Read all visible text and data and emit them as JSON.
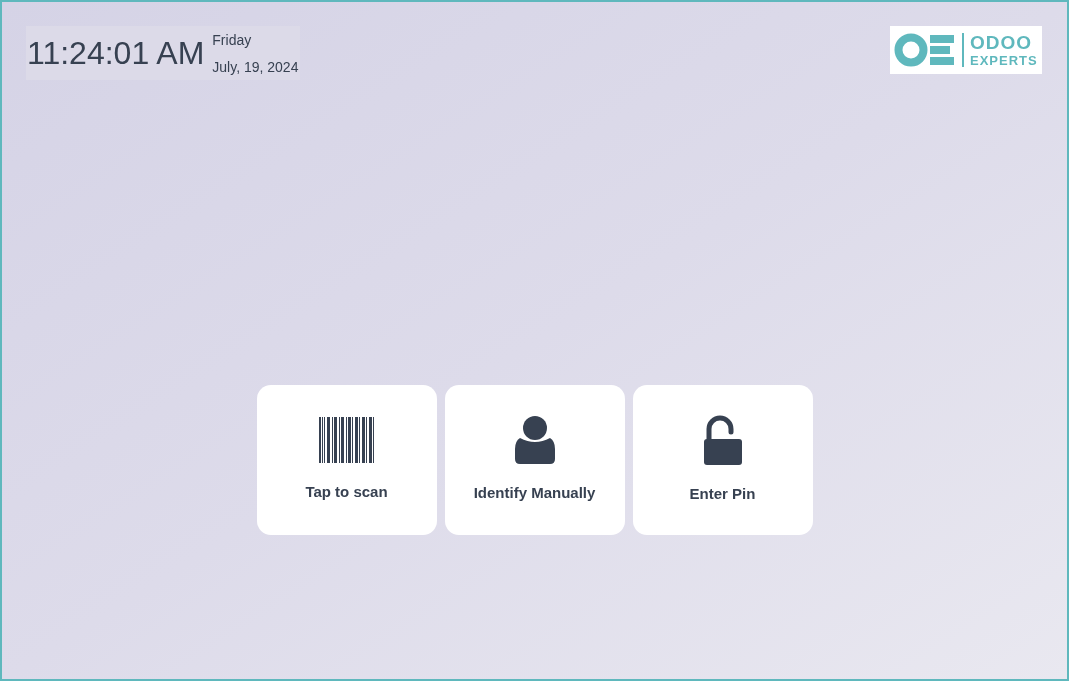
{
  "clock": {
    "time": "11:24:01 AM",
    "weekday": "Friday",
    "date": "July, 19, 2024"
  },
  "logo": {
    "line_1": "ODOO",
    "line_2": "EXPERTS"
  },
  "actions": [
    {
      "kind": "barcode",
      "label": "Tap to scan"
    },
    {
      "kind": "person",
      "label": "Identify Manually"
    },
    {
      "kind": "lock",
      "label": "Enter Pin"
    }
  ]
}
